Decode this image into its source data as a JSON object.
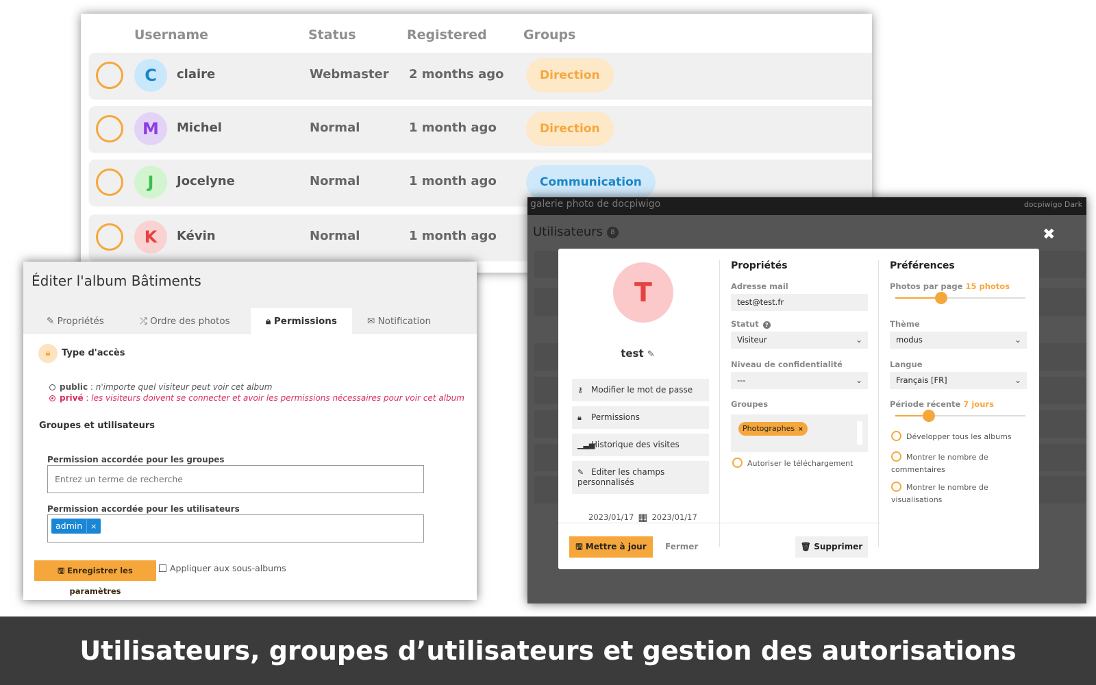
{
  "user_list": {
    "columns": [
      "Username",
      "Status",
      "Registered",
      "Groups"
    ],
    "rows": [
      {
        "initial": "C",
        "name": "claire",
        "status": "Webmaster",
        "registered": "2 months ago",
        "group": "Direction"
      },
      {
        "initial": "M",
        "name": "Michel",
        "status": "Normal",
        "registered": "1 month ago",
        "group": "Direction"
      },
      {
        "initial": "J",
        "name": "Jocelyne",
        "status": "Normal",
        "registered": "1 month ago",
        "group": "Communication"
      },
      {
        "initial": "K",
        "name": "Kévin",
        "status": "Normal",
        "registered": "1 month ago",
        "group": ""
      }
    ],
    "avatar_colors": [
      "#c9e8fb",
      "#e3d4f7",
      "#d2f5cf",
      "#fbd2d2"
    ],
    "avatar_text_colors": [
      "#1a87c6",
      "#8b3fe3",
      "#3bbf4b",
      "#e64242"
    ]
  },
  "album_editor": {
    "title": "Éditer l'album Bâtiments",
    "tabs": [
      "Propriétés",
      "Ordre des photos",
      "Permissions",
      "Notification"
    ],
    "tab_icons": [
      "pencil-icon",
      "shuffle-icon",
      "lock-icon",
      "envelope-icon"
    ],
    "active_tab": "Permissions",
    "access_heading": "Type d'accès",
    "public_label": "public",
    "public_desc": "n'importe quel visiteur peut voir cet album",
    "private_label": "privé",
    "private_desc": "les visiteurs doivent se connecter et avoir les permissions nécessaires pour voir cet album",
    "groups_users_heading": "Groupes et utilisateurs",
    "groups_perm_label": "Permission accordée pour les groupes",
    "groups_search_placeholder": "Entrez un terme de recherche",
    "users_perm_label": "Permission accordée pour les utilisateurs",
    "users_tag": "admin",
    "save_button": "Enregistrer les paramètres",
    "apply_sub_albums": "Appliquer aux sous-albums"
  },
  "admin_panel": {
    "gallery_title": "galerie photo de docpiwigo",
    "top_right": "docpiwigo   Dark",
    "page_title": "Utilisateurs",
    "user_count_badge": "8",
    "modal": {
      "avatar_initial": "T",
      "username": "test",
      "actions": [
        {
          "label": "Modifier le mot de passe",
          "icon": "key-icon"
        },
        {
          "label": "Permissions",
          "icon": "lock-icon"
        },
        {
          "label": "Historique des visites",
          "icon": "bar-chart-icon"
        },
        {
          "label": "Editer les champs personnalisés",
          "icon": "pencil-icon"
        }
      ],
      "date_start": "2023/01/17",
      "date_end": "2023/01/17",
      "properties": {
        "heading": "Propriétés",
        "email_label": "Adresse mail",
        "email_value": "test@test.fr",
        "status_label": "Statut",
        "status_value": "Visiteur",
        "privacy_label": "Niveau de confidentialité",
        "privacy_value": "---",
        "groups_label": "Groupes",
        "group_tag": "Photographes",
        "allow_download": "Autoriser le téléchargement"
      },
      "preferences": {
        "heading": "Préférences",
        "photos_per_page_label": "Photos par page",
        "photos_per_page_value": "15 photos",
        "photos_slider_fraction": 0.35,
        "theme_label": "Thème",
        "theme_value": "modus",
        "language_label": "Langue",
        "language_value": "Français [FR]",
        "recent_period_label": "Période récente",
        "recent_period_value": "7 jours",
        "recent_slider_fraction": 0.26,
        "options": [
          "Développer tous les albums",
          "Montrer le nombre de commentaires",
          "Montrer le nombre de visualisations"
        ]
      },
      "update_button": "Mettre à jour",
      "close_button": "Fermer",
      "delete_button": "Supprimer"
    }
  },
  "caption": "Utilisateurs, groupes d’utilisateurs et gestion des autorisations",
  "colors": {
    "accent": "#f6a73c",
    "footer": "#3b3b3b",
    "private": "#d92f5f",
    "tag_blue": "#1a87d6"
  }
}
